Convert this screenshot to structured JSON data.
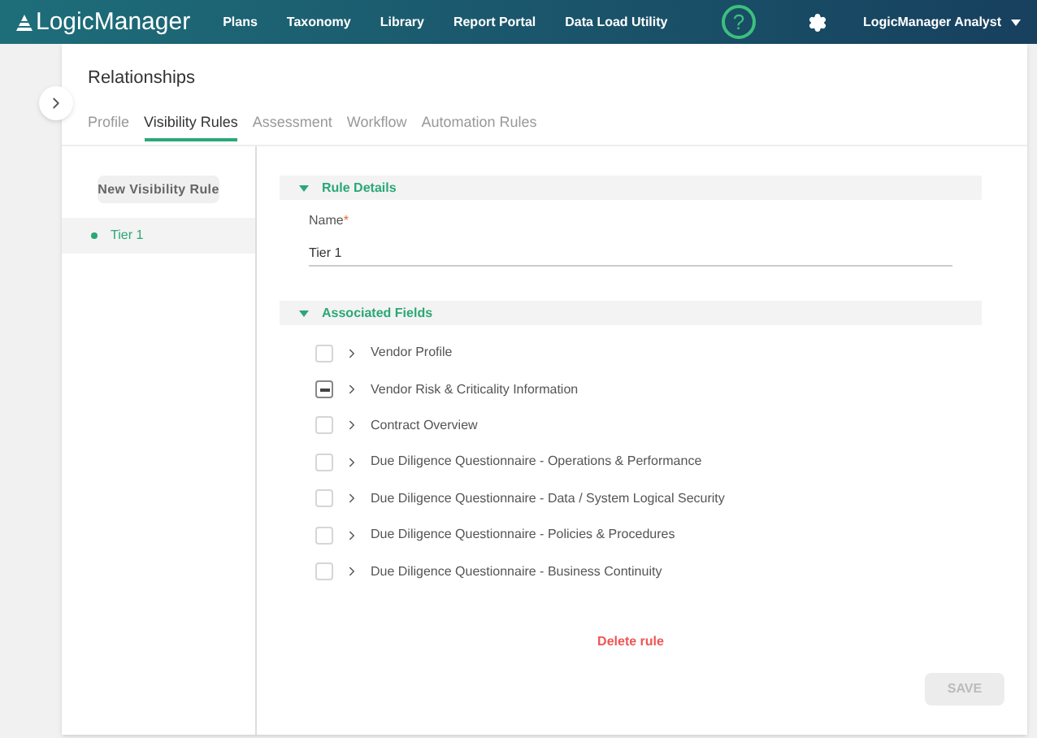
{
  "header": {
    "logo": "LogicManager",
    "nav": [
      {
        "label": "Plans"
      },
      {
        "label": "Taxonomy"
      },
      {
        "label": "Library"
      },
      {
        "label": "Report Portal"
      },
      {
        "label": "Data Load Utility"
      }
    ],
    "help": "?",
    "user": "LogicManager Analyst"
  },
  "page": {
    "title": "Relationships",
    "tabs": [
      {
        "label": "Profile",
        "selected": false
      },
      {
        "label": "Visibility Rules",
        "selected": true
      },
      {
        "label": "Assessment",
        "selected": false
      },
      {
        "label": "Workflow",
        "selected": false
      },
      {
        "label": "Automation Rules",
        "selected": false
      }
    ]
  },
  "rules": {
    "new_button": "New Visibility Rule",
    "items": [
      {
        "label": "Tier 1",
        "selected": true
      }
    ]
  },
  "rule_details": {
    "title": "Rule Details",
    "expanded": true,
    "name_label": "Name",
    "required_mark": "*",
    "name_value": "Tier 1"
  },
  "associated_fields": {
    "title": "Associated Fields",
    "expanded": true,
    "items": [
      {
        "label": "Vendor Profile",
        "checked": false,
        "indeterminate": false,
        "expanded": false
      },
      {
        "label": "Vendor Risk & Criticality Information",
        "checked": false,
        "indeterminate": true,
        "expanded": false
      },
      {
        "label": "Contract Overview",
        "checked": false,
        "indeterminate": false,
        "expanded": false
      },
      {
        "label": "Due Diligence Questionnaire - Operations & Performance",
        "checked": false,
        "indeterminate": false,
        "expanded": false
      },
      {
        "label": "Due Diligence Questionnaire - Data / System Logical Security",
        "checked": false,
        "indeterminate": false,
        "expanded": false
      },
      {
        "label": "Due Diligence Questionnaire - Policies & Procedures",
        "checked": false,
        "indeterminate": false,
        "expanded": false
      },
      {
        "label": "Due Diligence Questionnaire - Business Continuity",
        "checked": false,
        "indeterminate": false,
        "expanded": false
      }
    ]
  },
  "delete_link": "Delete rule",
  "save_button": {
    "label": "SAVE",
    "disabled": true
  }
}
